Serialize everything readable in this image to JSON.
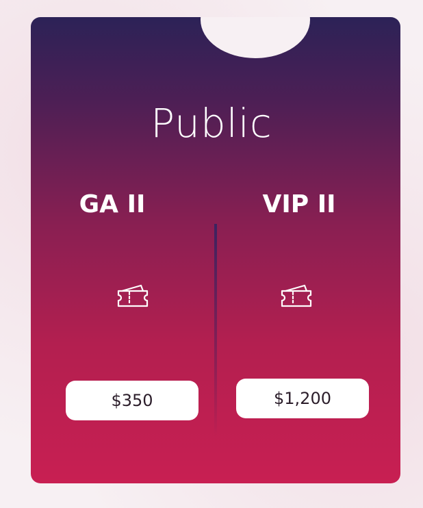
{
  "card": {
    "title": "Public"
  },
  "tiers": [
    {
      "name": "GA II",
      "price": "$350",
      "icon": "ticket-icon"
    },
    {
      "name": "VIP II",
      "price": "$1,200",
      "icon": "ticket-icon"
    }
  ],
  "colors": {
    "gradient_top": "#2c2257",
    "gradient_bottom": "#c81f52",
    "button_bg": "#ffffff",
    "text_light": "#ffffff",
    "text_dark": "#2b1d2a"
  }
}
